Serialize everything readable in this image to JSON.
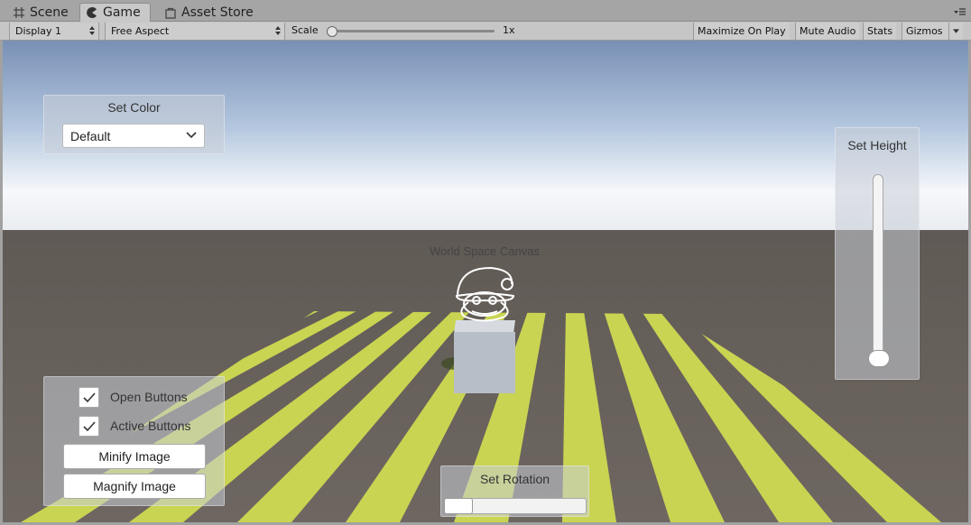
{
  "tabs": [
    {
      "label": "Scene",
      "icon": "grid-icon"
    },
    {
      "label": "Game",
      "icon": "pacman-icon",
      "active": true
    },
    {
      "label": "Asset Store",
      "icon": "store-bag-icon"
    }
  ],
  "toolbar": {
    "display": "Display 1",
    "aspect": "Free Aspect",
    "scale_label": "Scale",
    "scale_value": "1x",
    "maximize": "Maximize On Play",
    "mute": "Mute Audio",
    "stats": "Stats",
    "gizmos": "Gizmos"
  },
  "game": {
    "set_color": {
      "title": "Set Color",
      "selected": "Default"
    },
    "set_height": {
      "title": "Set Height",
      "value": 0.0
    },
    "set_rotation": {
      "title": "Set Rotation",
      "value": 0.0
    },
    "world_canvas_label": "World Space Canvas",
    "toggles": [
      {
        "label": "Open Buttons",
        "checked": true
      },
      {
        "label": "Active Buttons",
        "checked": true
      }
    ],
    "buttons": {
      "minify": "Minify Image",
      "magnify": "Magnify Image"
    }
  },
  "colors": {
    "sky_top": "#7e96b8",
    "horizon": "#f4f7fb",
    "ground": "#6b645e",
    "stripe": "#c9d452",
    "cube": "#b8bec7"
  }
}
